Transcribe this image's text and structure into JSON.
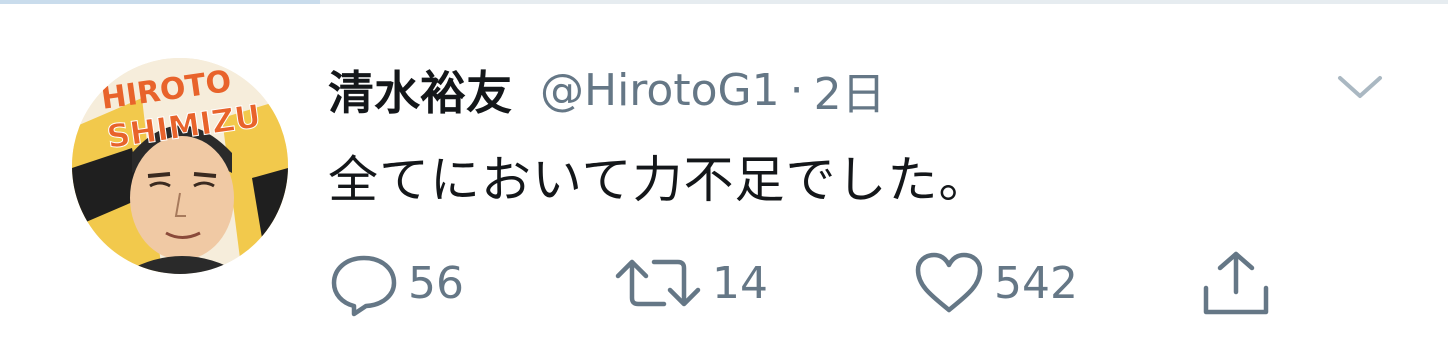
{
  "tweet": {
    "author_name": "清水裕友",
    "handle": "@HirotoG1",
    "separator": "·",
    "time": "2日",
    "text": "全てにおいて力不足でした。",
    "avatar_text_top": "HIROTO",
    "avatar_text_bottom": "SHIMIZU"
  },
  "actions": {
    "reply_count": "56",
    "retweet_count": "14",
    "like_count": "542"
  },
  "icons": {
    "reply": "speech-bubble-icon",
    "retweet": "retweet-icon",
    "like": "heart-icon",
    "share": "share-icon",
    "menu": "chevron-down-icon"
  },
  "colors": {
    "text": "#14171a",
    "secondary": "#657786",
    "avatar_accent": "#e8632b",
    "avatar_yellow": "#f2c94c"
  }
}
